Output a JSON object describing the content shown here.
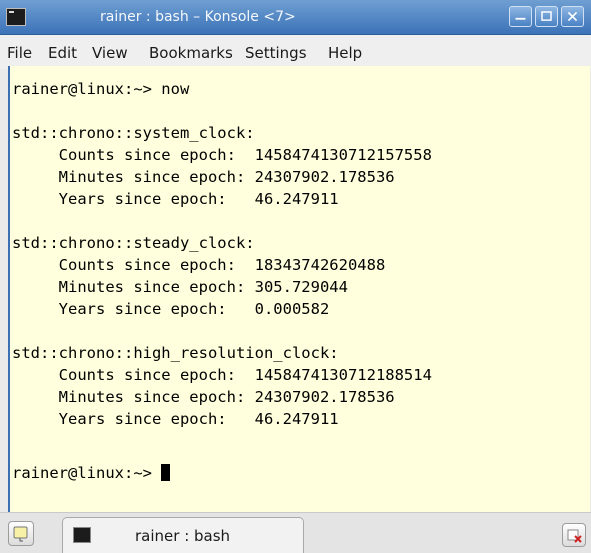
{
  "window": {
    "title": "rainer : bash – Konsole <7>"
  },
  "menubar": {
    "items": [
      "File",
      "Edit",
      "View",
      "Bookmarks",
      "Settings",
      "Help"
    ]
  },
  "terminal": {
    "lines": [
      "rainer@linux:~> now",
      "",
      "std::chrono::system_clock:",
      "     Counts since epoch:  1458474130712157558",
      "     Minutes since epoch: 24307902.178536",
      "     Years since epoch:   46.247911",
      "",
      "std::chrono::steady_clock:",
      "     Counts since epoch:  18343742620488",
      "     Minutes since epoch: 305.729044",
      "     Years since epoch:   0.000582",
      "",
      "std::chrono::high_resolution_clock:",
      "     Counts since epoch:  1458474130712188514",
      "     Minutes since epoch: 24307902.178536",
      "     Years since epoch:   46.247911",
      "",
      "rainer@linux:~> "
    ]
  },
  "tabbar": {
    "tab_label": "rainer : bash"
  },
  "colors": {
    "titlebar": "#4a82c4",
    "terminal_bg": "#ffffdd",
    "menubar_bg": "#efefef"
  },
  "icons": {
    "app": "terminal-icon",
    "minimize": "minimize-icon",
    "maximize": "maximize-icon",
    "close": "close-icon",
    "new_tab": "new-tab-icon",
    "close_tab": "close-tab-icon"
  }
}
